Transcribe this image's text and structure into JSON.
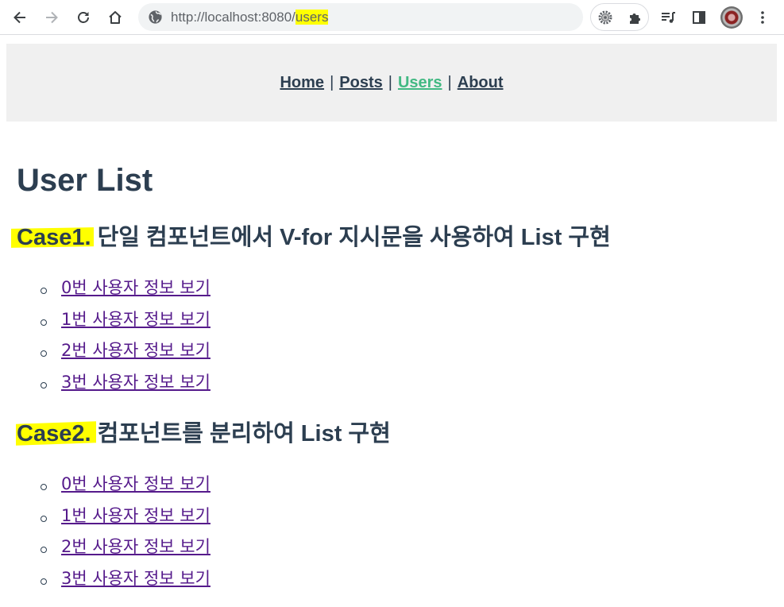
{
  "browser": {
    "url_base": "http://localhost:8080/",
    "url_path": "users"
  },
  "nav": {
    "home": "Home",
    "posts": "Posts",
    "users": "Users",
    "about": "About",
    "separator": "|"
  },
  "page": {
    "title": "User List"
  },
  "case1": {
    "label": "Case1.",
    "text": " 단일 컴포넌트에서 V-for 지시문을 사용하여 List 구현",
    "items": [
      "0번 사용자 정보 보기",
      "1번 사용자 정보 보기",
      "2번 사용자 정보 보기",
      "3번 사용자 정보 보기"
    ]
  },
  "case2": {
    "label": "Case2.",
    "text": " 컴포넌트를 분리하여 List 구현",
    "items": [
      "0번 사용자 정보 보기",
      "1번 사용자 정보 보기",
      "2번 사용자 정보 보기",
      "3번 사용자 정보 보기"
    ]
  },
  "colors": {
    "text": "#2c3e50",
    "active_link": "#42b983",
    "visited_link": "#551a8b",
    "highlight": "#ffff00",
    "nav_background": "#f0f0f0"
  }
}
